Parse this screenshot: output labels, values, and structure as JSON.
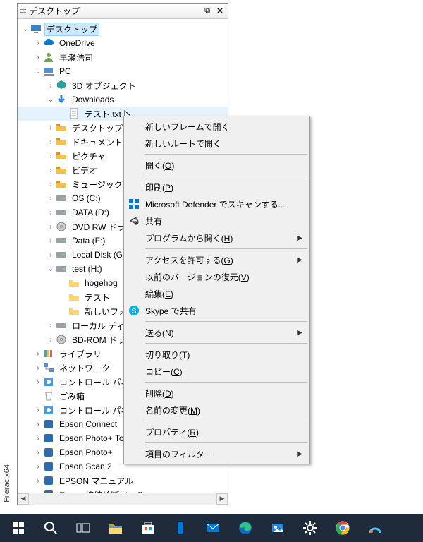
{
  "app_name": "Filerac.x64",
  "titlebar": {
    "title": "デスクトップ"
  },
  "tree": [
    {
      "d": 0,
      "tw": "v",
      "ico": "desktop",
      "c": "#3b82c4",
      "lbl": "デスクトップ",
      "sel": true
    },
    {
      "d": 1,
      "tw": ">",
      "ico": "cloud",
      "c": "#0078d4",
      "lbl": "OneDrive"
    },
    {
      "d": 1,
      "tw": ">",
      "ico": "user",
      "c": "#6aa84f",
      "lbl": "早瀬浩司"
    },
    {
      "d": 1,
      "tw": "v",
      "ico": "pc",
      "c": "#5b8dd6",
      "lbl": "PC"
    },
    {
      "d": 2,
      "tw": ">",
      "ico": "3d",
      "c": "#2aa198",
      "lbl": "3D オブジェクト"
    },
    {
      "d": 2,
      "tw": "v",
      "ico": "down",
      "c": "#2b88d8",
      "lbl": "Downloads"
    },
    {
      "d": 3,
      "tw": " ",
      "ico": "txt",
      "c": "#ffffff",
      "lbl": "テスト.txt",
      "hl": true,
      "cursor": true
    },
    {
      "d": 2,
      "tw": ">",
      "ico": "folder",
      "c": "#f8c146",
      "lbl": "デスクトップ"
    },
    {
      "d": 2,
      "tw": ">",
      "ico": "folder",
      "c": "#f8c146",
      "lbl": "ドキュメント"
    },
    {
      "d": 2,
      "tw": ">",
      "ico": "folder",
      "c": "#f8c146",
      "lbl": "ピクチャ"
    },
    {
      "d": 2,
      "tw": ">",
      "ico": "folder",
      "c": "#f8c146",
      "lbl": "ビデオ"
    },
    {
      "d": 2,
      "tw": ">",
      "ico": "folder",
      "c": "#f8c146",
      "lbl": "ミュージック"
    },
    {
      "d": 2,
      "tw": ">",
      "ico": "disk",
      "c": "#9aa0a6",
      "lbl": "OS (C:)"
    },
    {
      "d": 2,
      "tw": ">",
      "ico": "disk",
      "c": "#9aa0a6",
      "lbl": "DATA (D:)"
    },
    {
      "d": 2,
      "tw": ">",
      "ico": "dvd",
      "c": "#888",
      "lbl": "DVD RW ドラ"
    },
    {
      "d": 2,
      "tw": ">",
      "ico": "disk",
      "c": "#9aa0a6",
      "lbl": "Data (F:)"
    },
    {
      "d": 2,
      "tw": ">",
      "ico": "disk",
      "c": "#9aa0a6",
      "lbl": "Local Disk (G"
    },
    {
      "d": 2,
      "tw": "v",
      "ico": "disk",
      "c": "#9aa0a6",
      "lbl": "test (H:)"
    },
    {
      "d": 3,
      "tw": " ",
      "ico": "folder2",
      "c": "#ffd76a",
      "lbl": "hogehog"
    },
    {
      "d": 3,
      "tw": " ",
      "ico": "folder2",
      "c": "#ffd76a",
      "lbl": "テスト"
    },
    {
      "d": 3,
      "tw": " ",
      "ico": "folder2",
      "c": "#ffd76a",
      "lbl": "新しいフォ"
    },
    {
      "d": 2,
      "tw": ">",
      "ico": "disk",
      "c": "#9aa0a6",
      "lbl": "ローカル ディス"
    },
    {
      "d": 2,
      "tw": ">",
      "ico": "dvd",
      "c": "#888",
      "lbl": "BD-ROM ドラ"
    },
    {
      "d": 1,
      "tw": ">",
      "ico": "lib",
      "c": "#f8c146",
      "lbl": "ライブラリ"
    },
    {
      "d": 1,
      "tw": ">",
      "ico": "net",
      "c": "#5b8dd6",
      "lbl": "ネットワーク"
    },
    {
      "d": 1,
      "tw": ">",
      "ico": "cp",
      "c": "#4b9bd8",
      "lbl": "コントロール パネル"
    },
    {
      "d": 1,
      "tw": " ",
      "ico": "bin",
      "c": "#e0e0e0",
      "lbl": "ごみ箱"
    },
    {
      "d": 1,
      "tw": ">",
      "ico": "cp",
      "c": "#4b9bd8",
      "lbl": "コントロール パネル"
    },
    {
      "d": 1,
      "tw": ">",
      "ico": "app",
      "c": "#2b6cb0",
      "lbl": "Epson Connect"
    },
    {
      "d": 1,
      "tw": ">",
      "ico": "app",
      "c": "#2b6cb0",
      "lbl": "Epson Photo+ Too"
    },
    {
      "d": 1,
      "tw": ">",
      "ico": "app",
      "c": "#2b6cb0",
      "lbl": "Epson Photo+"
    },
    {
      "d": 1,
      "tw": ">",
      "ico": "app",
      "c": "#2b6cb0",
      "lbl": "Epson Scan 2"
    },
    {
      "d": 1,
      "tw": ">",
      "ico": "app",
      "c": "#2b6cb0",
      "lbl": "EPSON マニュアル"
    },
    {
      "d": 1,
      "tw": ">",
      "ico": "app",
      "c": "#2b6cb0",
      "lbl": "Epson 接続診断ツール"
    }
  ],
  "context_menu": [
    {
      "t": "item",
      "label": "新しいフレームで開く"
    },
    {
      "t": "item",
      "label": "新しいルートで開く"
    },
    {
      "t": "sep"
    },
    {
      "t": "item",
      "label_html": "開く(<u>O</u>)"
    },
    {
      "t": "sep"
    },
    {
      "t": "item",
      "label_html": "印刷(<u>P</u>)"
    },
    {
      "t": "item",
      "icon": "defender",
      "label": "Microsoft Defender でスキャンする..."
    },
    {
      "t": "item",
      "icon": "share",
      "label": "共有"
    },
    {
      "t": "item",
      "label_html": "プログラムから開く(<u>H</u>)",
      "sub": true
    },
    {
      "t": "sep"
    },
    {
      "t": "item",
      "label_html": "アクセスを許可する(<u>G</u>)",
      "sub": true
    },
    {
      "t": "item",
      "label_html": "以前のバージョンの復元(<u>V</u>)"
    },
    {
      "t": "item",
      "label_html": "編集(<u>E</u>)"
    },
    {
      "t": "item",
      "icon": "skype",
      "label": "Skype で共有"
    },
    {
      "t": "sep"
    },
    {
      "t": "item",
      "label_html": "送る(<u>N</u>)",
      "sub": true
    },
    {
      "t": "sep"
    },
    {
      "t": "item",
      "label_html": "切り取り(<u>T</u>)"
    },
    {
      "t": "item",
      "label_html": "コピー(<u>C</u>)"
    },
    {
      "t": "sep"
    },
    {
      "t": "item",
      "label_html": "削除(<u>D</u>)"
    },
    {
      "t": "item",
      "label_html": "名前の変更(<u>M</u>)"
    },
    {
      "t": "sep"
    },
    {
      "t": "item",
      "label_html": "プロパティ(<u>R</u>)"
    },
    {
      "t": "sep"
    },
    {
      "t": "item",
      "label": "項目のフィルター",
      "sub": true
    }
  ],
  "taskbar": [
    "start",
    "search",
    "taskview",
    "explorer",
    "store",
    "phone",
    "mail",
    "edge",
    "photos",
    "settings",
    "chrome",
    "paint"
  ]
}
